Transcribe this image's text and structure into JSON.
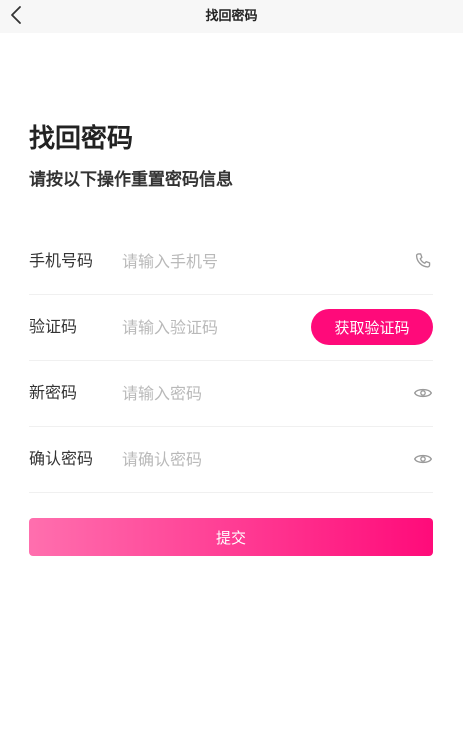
{
  "navbar": {
    "back_icon": "chevron-left-icon",
    "title": "找回密码"
  },
  "header": {
    "title": "找回密码",
    "subtitle": "请按以下操作重置密码信息"
  },
  "form": {
    "phone": {
      "label": "手机号码",
      "placeholder": "请输入手机号",
      "value": "",
      "icon": "phone-icon"
    },
    "code": {
      "label": "验证码",
      "placeholder": "请输入验证码",
      "value": "",
      "button_label": "获取验证码"
    },
    "new_password": {
      "label": "新密码",
      "placeholder": "请输入密码",
      "value": "",
      "icon": "eye-icon"
    },
    "confirm_password": {
      "label": "确认密码",
      "placeholder": "请确认密码",
      "value": "",
      "icon": "eye-icon"
    }
  },
  "submit_label": "提交",
  "colors": {
    "accent": "#ff0a7a",
    "gradient_start": "#ff6fae",
    "gradient_end": "#ff0b7a",
    "navbar_bg": "#f7f7f7",
    "placeholder": "#b9b9b9",
    "icon": "#9a9a9a"
  }
}
